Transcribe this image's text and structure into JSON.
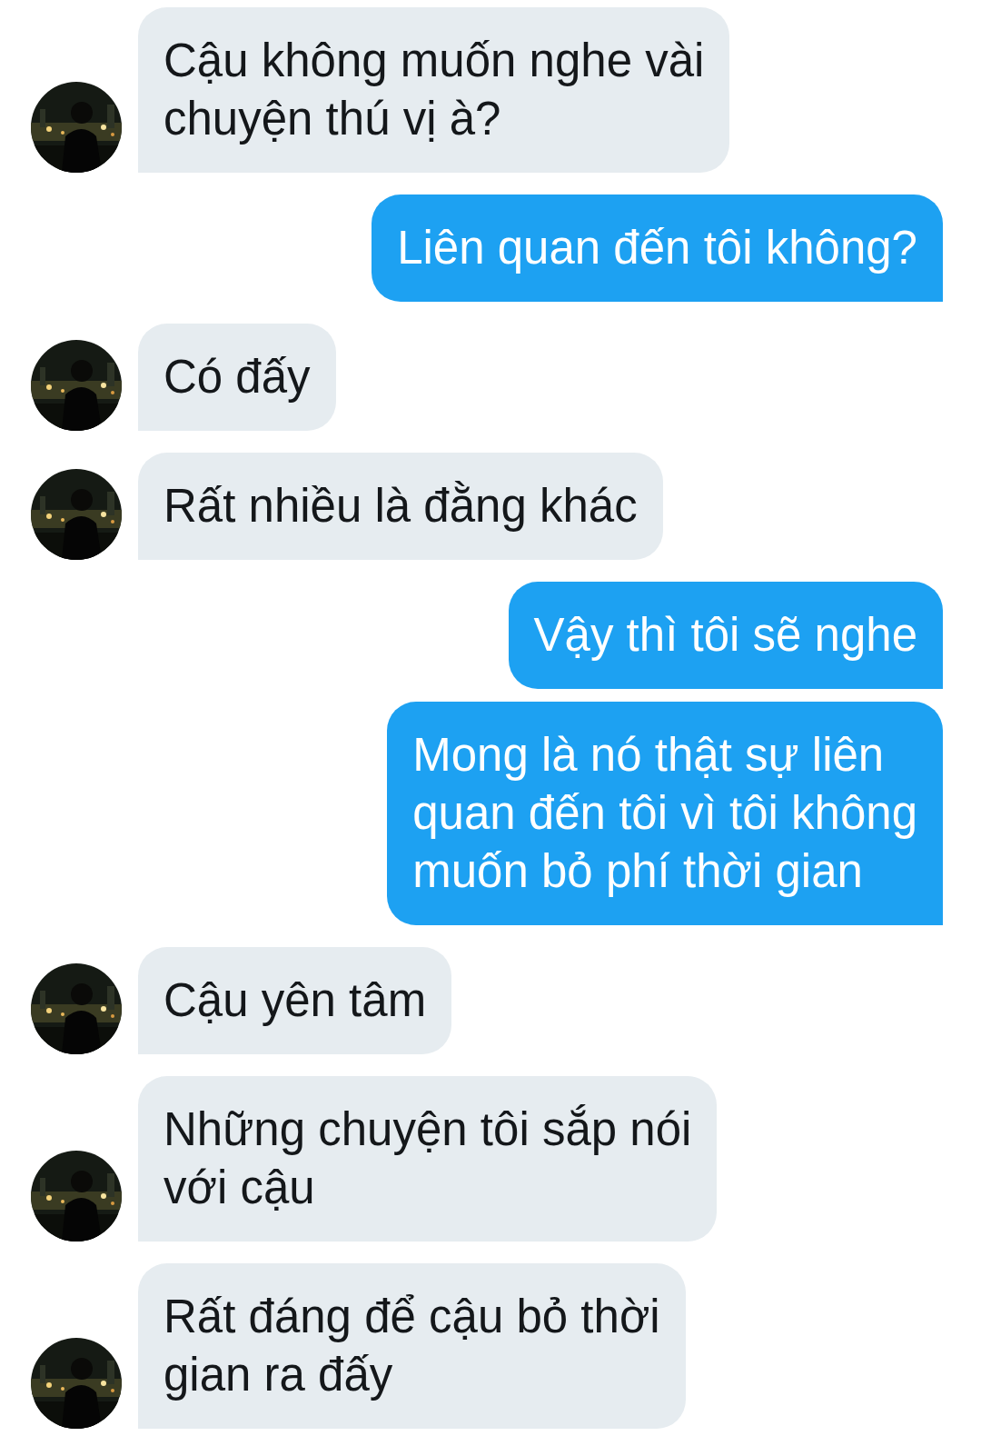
{
  "messages": [
    {
      "kind": "incoming",
      "avatar": {
        "kind": "picture"
      },
      "lines": [
        "Cậu không muốn nghe vài",
        "chuyện thú vị à?"
      ]
    },
    {
      "kind": "outgoing",
      "lines": [
        "Liên quan đến tôi không?"
      ]
    },
    {
      "kind": "incoming",
      "avatar": {
        "kind": "picture"
      },
      "lines": [
        "Có đấy"
      ]
    },
    {
      "kind": "incoming",
      "avatar": {
        "kind": "picture"
      },
      "lines": [
        "Rất nhiều là đằng khác"
      ]
    },
    {
      "kind": "outgoing",
      "lines": [
        "Vậy thì tôi sẽ nghe"
      ]
    },
    {
      "kind": "outgoing",
      "lines": [
        "Mong là nó thật sự liên",
        "quan đến tôi vì tôi không",
        "muốn bỏ phí thời gian"
      ]
    },
    {
      "kind": "incoming",
      "avatar": {
        "kind": "picture"
      },
      "lines": [
        "Cậu yên tâm"
      ]
    },
    {
      "kind": "incoming",
      "avatar": {
        "kind": "picture"
      },
      "lines": [
        "Những chuyện tôi sắp nói",
        "với cậu"
      ]
    },
    {
      "kind": "incoming",
      "avatar": {
        "kind": "picture"
      },
      "lines": [
        "Rất đáng để cậu bỏ thời",
        "gian ra đấy"
      ]
    }
  ]
}
